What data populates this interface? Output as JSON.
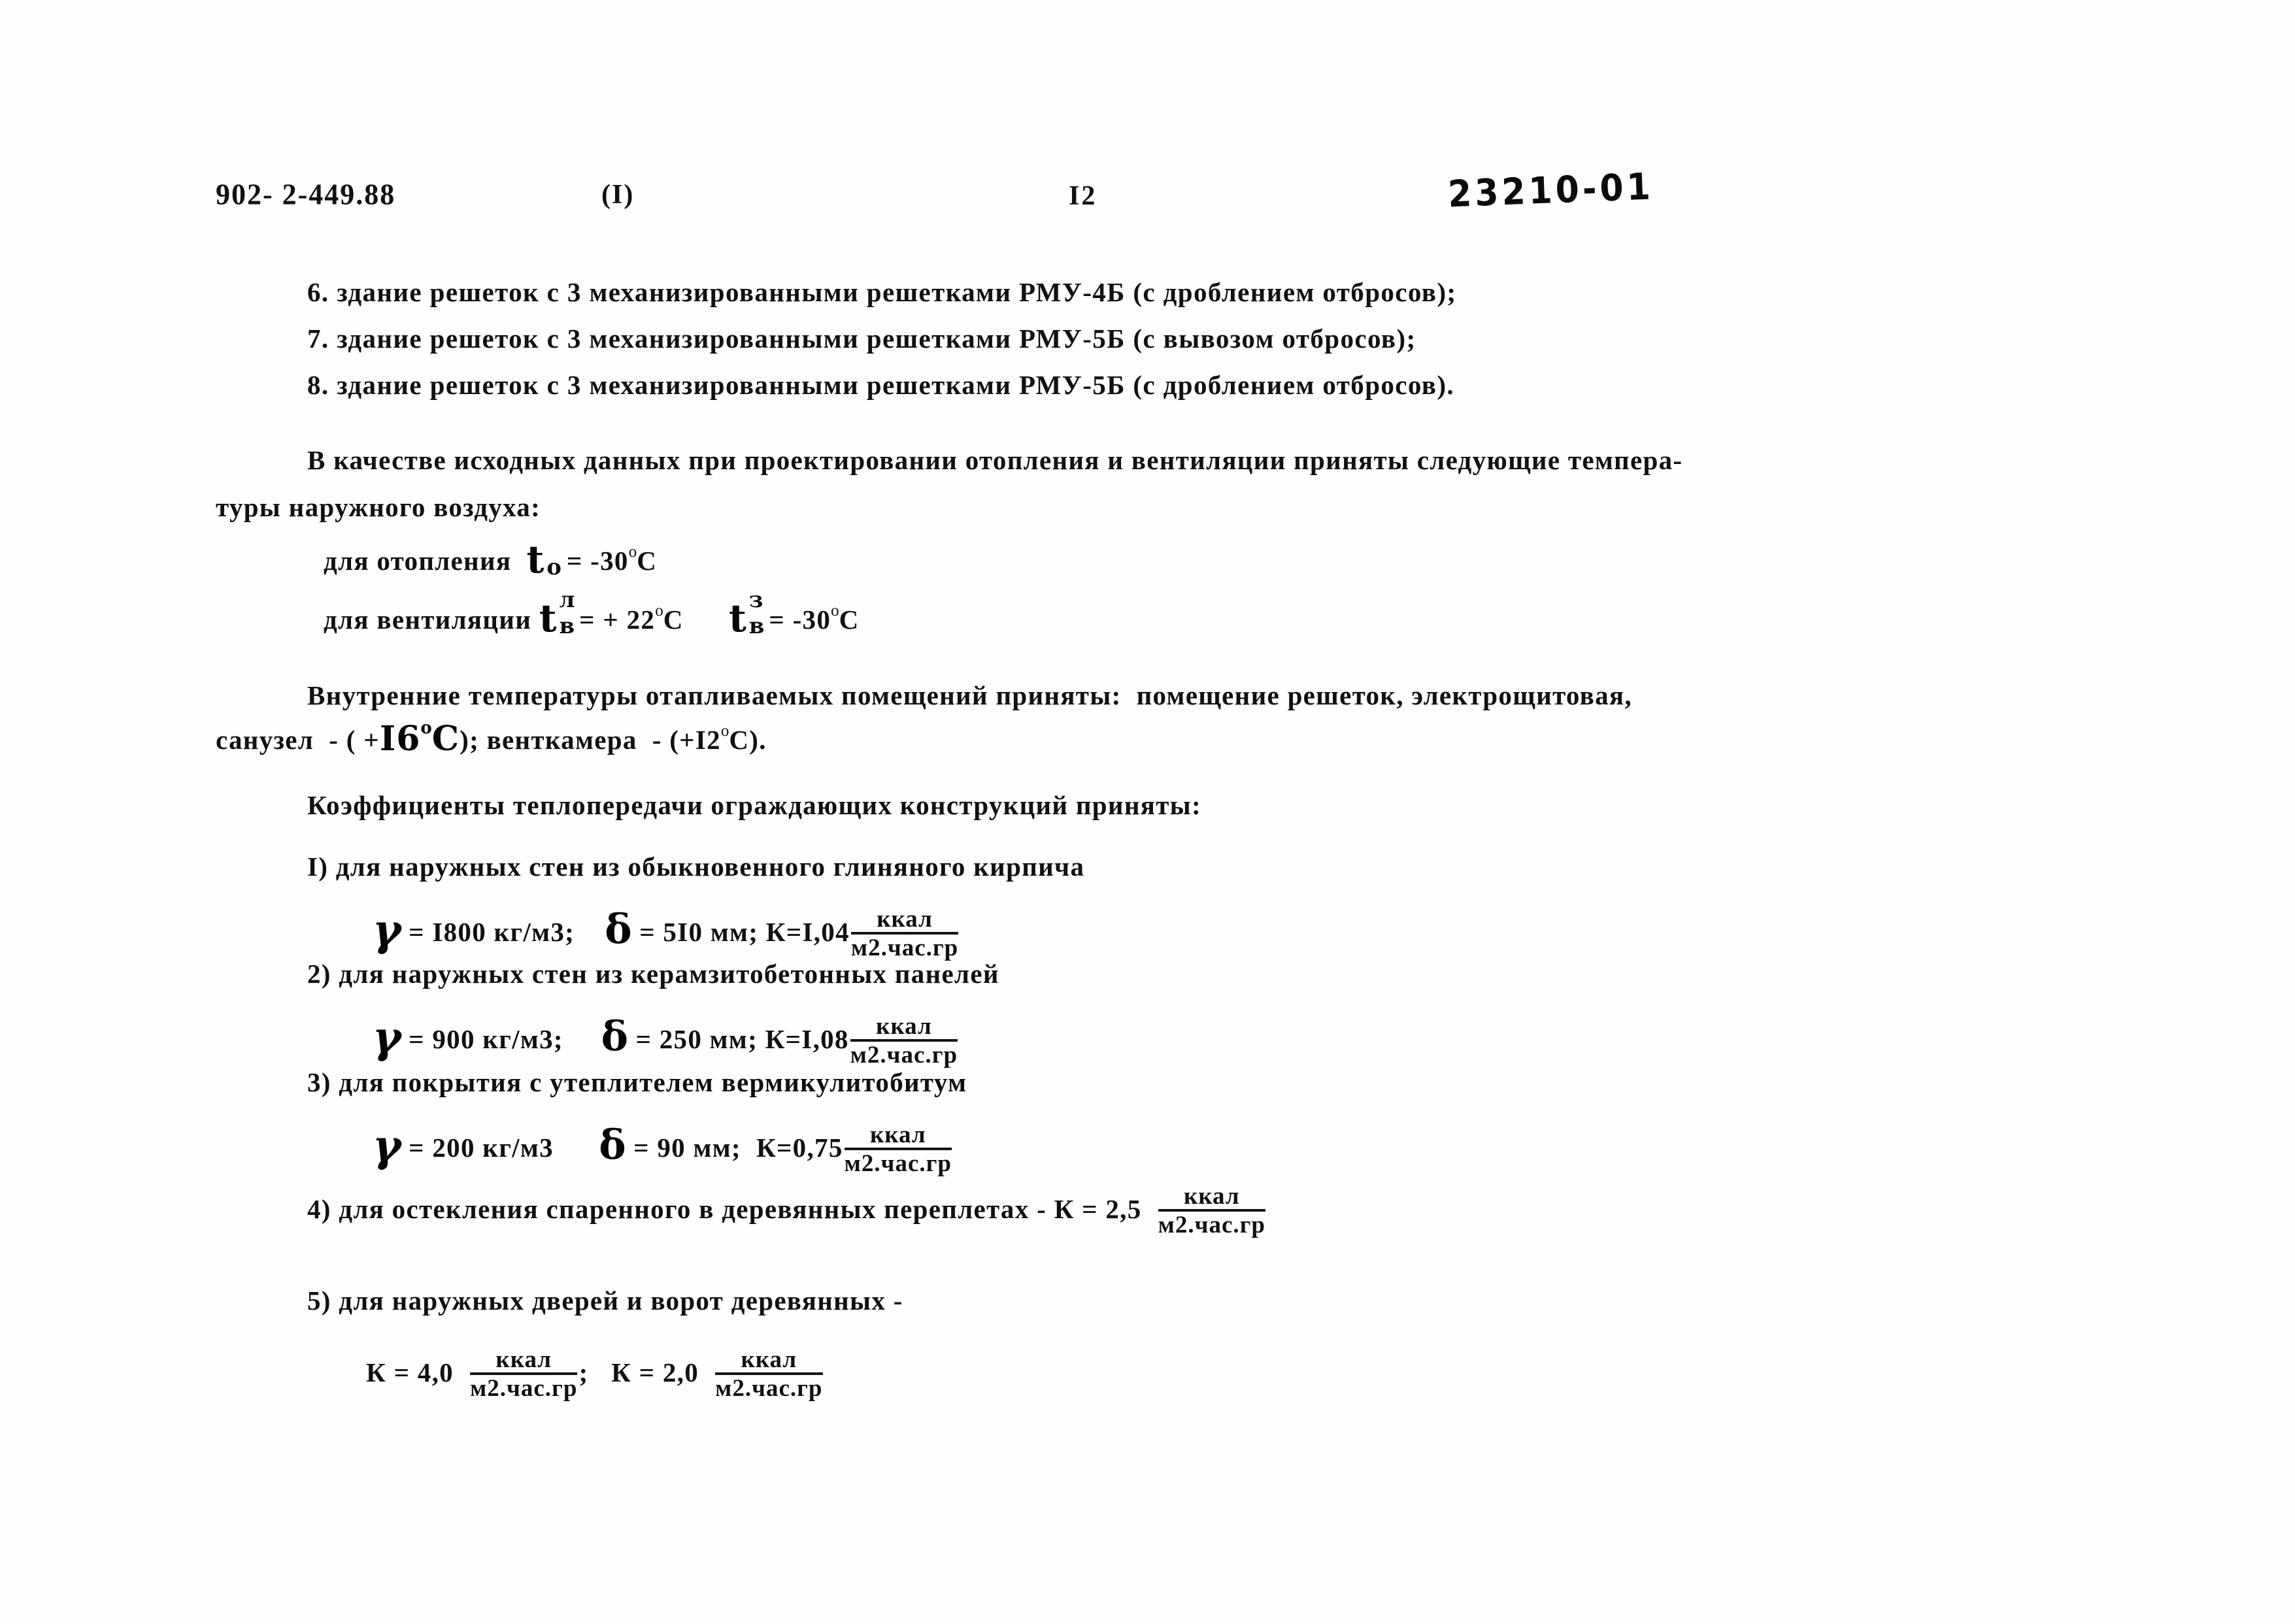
{
  "header": {
    "code": "902- 2-449.88",
    "part": "(I)",
    "page": "I2",
    "stamp": "23210-01"
  },
  "list_items": [
    "6. здание решеток с 3 механизированными решетками РМУ-4Б (с дроблением отбросов);",
    "7. здание решеток с 3 механизированными решетками РМУ-5Б (с вывозом отбросов);",
    "8. здание решеток с 3 механизированными решетками РМУ-5Б (с дроблением отбросов)."
  ],
  "intro": {
    "line1": "В качестве исходных данных при проектировании отопления и вентиляции приняты следующие темпера-",
    "line2": "туры наружного воздуха:"
  },
  "outdoor": {
    "heating_label": "для отопления",
    "heating_symbol": "t",
    "heating_sub": "о",
    "heating_value": "= -30",
    "heating_unit": "С",
    "heating_degree": "о",
    "vent_label": "для вентиляции",
    "vent1_symbol": "t",
    "vent1_sup": "л",
    "vent1_sub": "в",
    "vent1_value": "= + 22",
    "vent1_degree": "о",
    "vent1_unit": "С",
    "vent2_symbol": "t",
    "vent2_sup": "з",
    "vent2_sub": "в",
    "vent2_value": "= -30",
    "vent2_degree": "о",
    "vent2_unit": "С"
  },
  "indoor": {
    "line1": "Внутренние температуры отапливаемых помещений приняты:  помещение решеток, электрощитовая,",
    "line2_a": "санузел  - ( +",
    "line2_handwritten": "I6",
    "line2_hw_degree": "о",
    "line2_hw_unit": "С",
    "line2_b": "); венткамера  - (+I2",
    "line2_degree": "о",
    "line2_c": "С)."
  },
  "coef": {
    "title": "Коэффициенты теплопередачи ограждающих конструкций приняты:",
    "items": [
      {
        "label": "I) для наружных стен из обыкновенного глиняного кирпича",
        "gamma": "γ",
        "gamma_value": "= I800 кг/м3;",
        "delta": "δ",
        "delta_value": "= 5I0 мм; К=I,04",
        "num": "ккал",
        "den": "м2.час.гр"
      },
      {
        "label": "2) для наружных стен из керамзитобетонных панелей",
        "gamma": "γ",
        "gamma_value": "= 900 кг/м3;",
        "delta": "δ",
        "delta_value": "= 250 мм; К=I,08",
        "num": "ккал",
        "den": "м2.час.гр"
      },
      {
        "label": "3) для покрытия с утеплителем вермикулитобитум",
        "gamma": "γ",
        "gamma_value": "= 200 кг/м3",
        "delta": "δ",
        "delta_value": "= 90 мм;  К=0,75",
        "num": "ккал",
        "den": "м2.час.гр"
      }
    ],
    "item4": {
      "label": "4) для остекления спаренного в деревянных переплетах - К = 2,5",
      "num": "ккал",
      "den": "м2.час.гр"
    },
    "item5": {
      "label": "5) для наружных дверей и ворот деревянных -",
      "k1_label": "К = 4,0",
      "k1_num": "ккал",
      "k1_den": "м2.час.гр",
      "separator": ";",
      "k2_label": "К = 2,0",
      "k2_num": "ккал",
      "k2_den": "м2.час.гр"
    }
  }
}
